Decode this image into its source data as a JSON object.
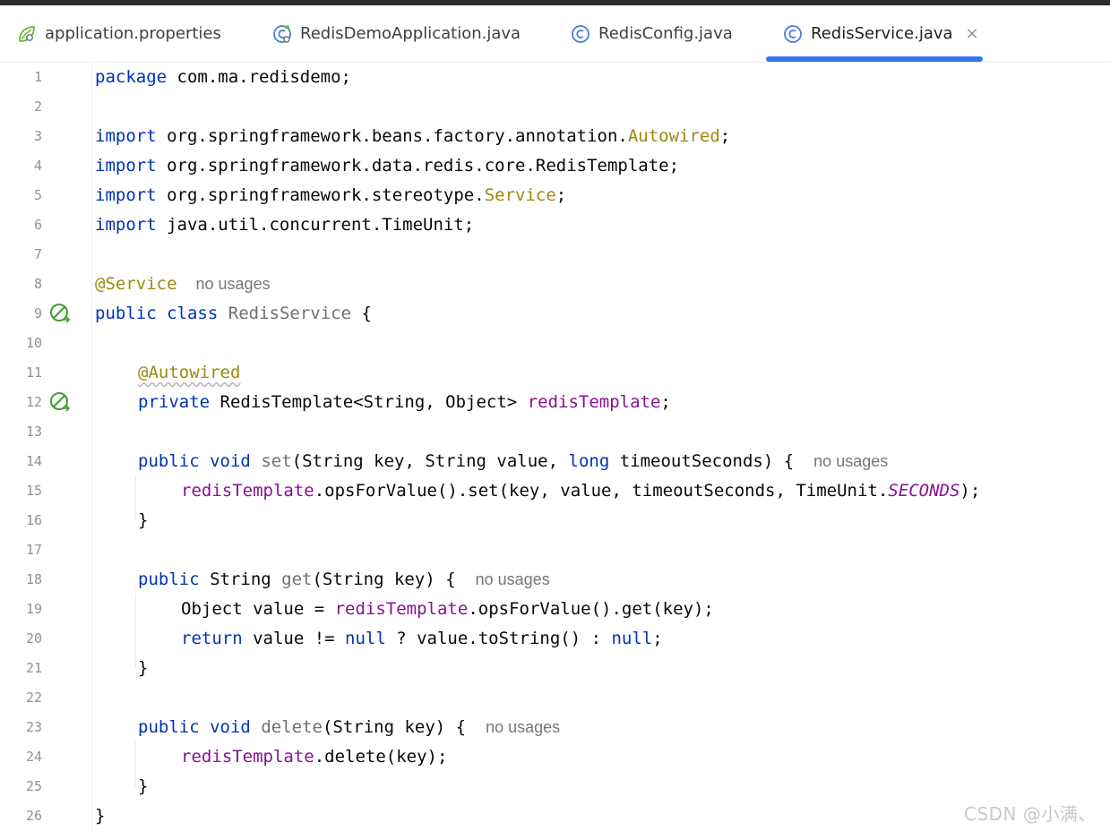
{
  "tabs": [
    {
      "label": "application.properties",
      "icon": "spring-properties-icon"
    },
    {
      "label": "RedisDemoApplication.java",
      "icon": "spring-boot-class-icon"
    },
    {
      "label": "RedisConfig.java",
      "icon": "class-icon"
    },
    {
      "label": "RedisService.java",
      "icon": "class-icon",
      "active": true,
      "close": "×"
    }
  ],
  "editor": {
    "line_numbers": [
      "1",
      "2",
      "3",
      "4",
      "5",
      "6",
      "7",
      "8",
      "9",
      "10",
      "11",
      "12",
      "13",
      "14",
      "15",
      "16",
      "17",
      "18",
      "19",
      "20",
      "21",
      "22",
      "23",
      "24",
      "25",
      "26"
    ],
    "hint": "no usages",
    "l1": {
      "kw": "package",
      "rest": " com.ma.redisdemo;"
    },
    "l3": {
      "kw": "import",
      "pre": " org.springframework.beans.factory.annotation.",
      "name": "Autowired",
      "post": ";"
    },
    "l4": {
      "kw": "import",
      "rest": " org.springframework.data.redis.core.RedisTemplate;"
    },
    "l5": {
      "kw": "import",
      "pre": " org.springframework.stereotype.",
      "name": "Service",
      "post": ";"
    },
    "l6": {
      "kw": "import",
      "rest": " java.util.concurrent.TimeUnit;"
    },
    "l8": {
      "ann": "@Service"
    },
    "l9": {
      "kw1": "public",
      "kw2": "class",
      "name": "RedisService",
      "post": " {"
    },
    "l11": {
      "ann": "@Autowired"
    },
    "l12": {
      "kw": "private",
      "pre": " RedisTemplate<String, Object> ",
      "field": "redisTemplate",
      "post": ";"
    },
    "l14": {
      "kw1": "public",
      "kw2": "void",
      "method": "set",
      "pre": "(String key, String value, ",
      "kw3": "long",
      "post": " timeoutSeconds) {"
    },
    "l15": {
      "field": "redisTemplate",
      "pre": ".opsForValue().set(key, value, timeoutSeconds, TimeUnit.",
      "const": "SECONDS",
      "post": ");"
    },
    "l16": {
      "text": "}"
    },
    "l18": {
      "kw": "public",
      "pre": " String ",
      "method": "get",
      "post": "(String key) {"
    },
    "l19": {
      "pre": "Object value = ",
      "field": "redisTemplate",
      "post": ".opsForValue().get(key);"
    },
    "l20": {
      "kw": "return",
      "pre": " value != ",
      "kw2": "null",
      "mid": " ? value.toString() : ",
      "kw3": "null",
      "post": ";"
    },
    "l21": {
      "text": "}"
    },
    "l23": {
      "kw1": "public",
      "kw2": "void",
      "method": "delete",
      "post": "(String key) {"
    },
    "l24": {
      "field": "redisTemplate",
      "post": ".delete(key);"
    },
    "l25": {
      "text": "}"
    },
    "l26": {
      "text": "}"
    }
  },
  "gutter_icons": {
    "l9": "spring-bean-icon",
    "l12": "spring-autowired-icon"
  },
  "watermark": "CSDN @小满、"
}
